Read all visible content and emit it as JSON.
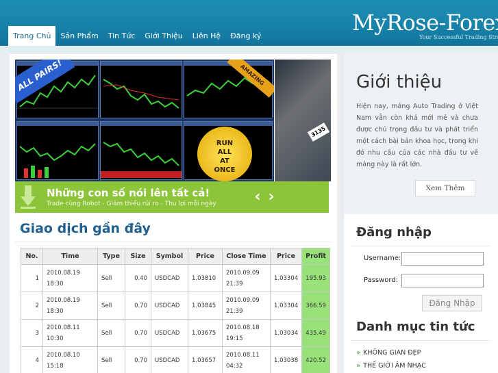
{
  "site": {
    "logo": "MyRose-Forex",
    "tagline": "Your Successful Trading Strategy"
  },
  "nav": {
    "items": [
      "Trang Chủ",
      "Sản Phẩm",
      "Tin Tức",
      "Giới Thiệu",
      "Liên Hệ",
      "Đăng ký"
    ],
    "active_index": 0
  },
  "slider": {
    "badge": "ALL PAIRS!",
    "badge2": "AMAZING",
    "seal": [
      "RUN",
      "ALL",
      "AT",
      "ONCE"
    ],
    "card_number": "3135",
    "caption_title": "Những con số nói lên tất cả!",
    "caption_subtitle": "Trade cùng Robot - Giảm thiểu rủi ro - Thu lợi mỗi ngày",
    "prev": "‹",
    "next": "›"
  },
  "intro": {
    "title": "Giới thiệu",
    "body": "Hiện nay, mảng Auto Trading ở Việt Nam vẫn còn khá mới mẻ và chưa được chú trọng đầu tư và phát triển một cách bài bản khoa học, trong khi đó nhu cầu của các nhà đầu tư về mảng này là rất lớn.",
    "more_label": "Xem Thêm"
  },
  "trades": {
    "title": "Giao dịch gần đây",
    "headers": [
      "No.",
      "Time",
      "Type",
      "Size",
      "Symbol",
      "Price",
      "Close Time",
      "Price",
      "Profit"
    ],
    "rows": [
      {
        "no": "1",
        "time": [
          "2010.08.19",
          "18:30"
        ],
        "type": "Sell",
        "size": "0.40",
        "symbol": "USDCAD",
        "price": "1.03810",
        "close": [
          "2010.09.09",
          "21:39"
        ],
        "close_price": "1.03304",
        "profit": "195.93"
      },
      {
        "no": "2",
        "time": [
          "2010.08.19",
          "18:30"
        ],
        "type": "Sell",
        "size": "0.70",
        "symbol": "USDCAD",
        "price": "1.03845",
        "close": [
          "2010.09.09",
          "21:39"
        ],
        "close_price": "1.03304",
        "profit": "366.59"
      },
      {
        "no": "3",
        "time": [
          "2010.08.11",
          "10:30"
        ],
        "type": "Sell",
        "size": "0.70",
        "symbol": "USDCAD",
        "price": "1.03675",
        "close": [
          "2010.08.18",
          "19:15"
        ],
        "close_price": "1.03034",
        "profit": "435.49"
      },
      {
        "no": "4",
        "time": [
          "2010.08.10",
          "15:18"
        ],
        "type": "Sell",
        "size": "0.70",
        "symbol": "USDCAD",
        "price": "1.03657",
        "close": [
          "2010.08.11",
          "04:32"
        ],
        "close_price": "1.03038",
        "profit": "420.52"
      }
    ]
  },
  "login": {
    "title": "Đăng nhập",
    "username_label": "Username:",
    "password_label": "Password:",
    "username_value": "",
    "password_value": "",
    "submit_label": "Đăng Nhập"
  },
  "categories": {
    "title": "Danh mục tin tức",
    "items": [
      "KHÔNG GIAN ĐẸP",
      "THẾ GIỚI ÂM NHẠC"
    ]
  },
  "colors": {
    "header": "#167fa6",
    "accent_green": "#8cc43a",
    "profit_cell": "#99e27a",
    "heading_blue": "#1f5f8e"
  },
  "icons": [
    "arrow-down-icon",
    "chevron-left-icon",
    "chevron-right-icon",
    "chevron-double-right-icon"
  ]
}
